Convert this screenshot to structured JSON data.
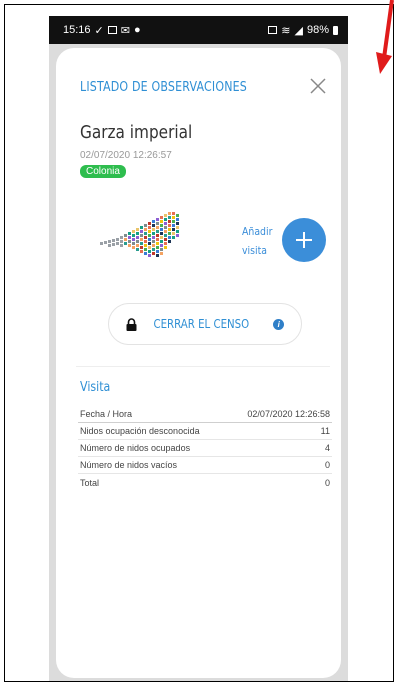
{
  "status_bar": {
    "time": "15:16",
    "left_icons": [
      "check-download-icon",
      "image-icon",
      "mail-icon",
      "chat-icon"
    ],
    "right_icons": [
      "nfc-icon",
      "wifi-icon",
      "signal-icon"
    ],
    "battery": "98%"
  },
  "header": {
    "title": "LISTADO DE OBSERVACIONES",
    "close_icon": "close-icon"
  },
  "observation": {
    "species": "Garza imperial",
    "datetime": "02/07/2020 12:26:57",
    "badge": "Colonia"
  },
  "actions": {
    "add_visit_line1": "Añadir",
    "add_visit_line2": "visita",
    "close_census_label": "CERRAR EL CENSO"
  },
  "visit": {
    "section_title": "Visita",
    "rows": [
      {
        "label": "Fecha / Hora",
        "value": "02/07/2020 12:26:58"
      },
      {
        "label": "Nidos ocupación desconocida",
        "value": "11"
      },
      {
        "label": "Número de nidos ocupados",
        "value": "4"
      },
      {
        "label": "Número de nidos vacíos",
        "value": "0"
      },
      {
        "label": "Total",
        "value": "0"
      }
    ]
  },
  "colors": {
    "accent": "#2f8fd4",
    "badge_green": "#2ebd4e",
    "annotation_arrow": "#e01b1b"
  }
}
